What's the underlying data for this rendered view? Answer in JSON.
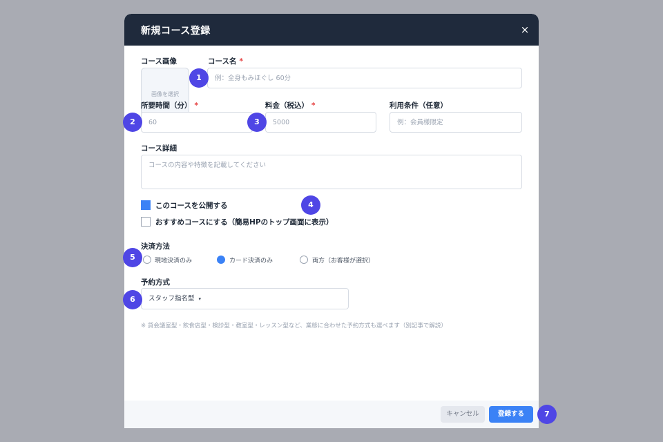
{
  "modal": {
    "title": "新規コース登録",
    "close_glyph": "×"
  },
  "form": {
    "course_image": {
      "label": "コース画像",
      "button_text": "画像を選択"
    },
    "course_name": {
      "label": "コース名",
      "required_mark": "*",
      "placeholder": "例：全身もみほぐし 60分"
    },
    "duration": {
      "label": "所要時間（分）",
      "required_mark": "*",
      "placeholder": "60"
    },
    "price": {
      "label": "料金（税込）",
      "required_mark": "*",
      "placeholder": "5000"
    },
    "conditions": {
      "label": "利用条件（任意）",
      "placeholder": "例：会員様限定"
    },
    "details": {
      "label": "コース詳細",
      "placeholder": "コースの内容や特徴を記載してください"
    },
    "publish_checkbox": {
      "label": "このコースを公開する",
      "checked": true
    },
    "recommend_checkbox": {
      "label": "おすすめコースにする（簡易HPのトップ画面に表示）",
      "checked": false
    },
    "payment": {
      "label": "決済方法",
      "options": [
        {
          "label": "現地決済のみ",
          "selected": false
        },
        {
          "label": "カード決済のみ",
          "selected": true
        },
        {
          "label": "両方（お客様が選択）",
          "selected": false
        }
      ]
    },
    "booking_type": {
      "label": "予約方式",
      "selected_value": "スタッフ指名型",
      "caret": "▾"
    },
    "note": "※ 貸会議室型・飲食店型・検診型・教室型・レッスン型など、業態に合わせた予約方式も選べます（別記事で解説）"
  },
  "footer": {
    "cancel_label": "キャンセル",
    "submit_label": "登録する"
  },
  "markers": [
    "1",
    "2",
    "3",
    "4",
    "5",
    "6",
    "7"
  ],
  "colors": {
    "header_bg": "#1f2a3c",
    "accent": "#3b82f6",
    "marker": "#4f46e5",
    "required": "#e53e3e",
    "backdrop": "#a9abb3"
  }
}
